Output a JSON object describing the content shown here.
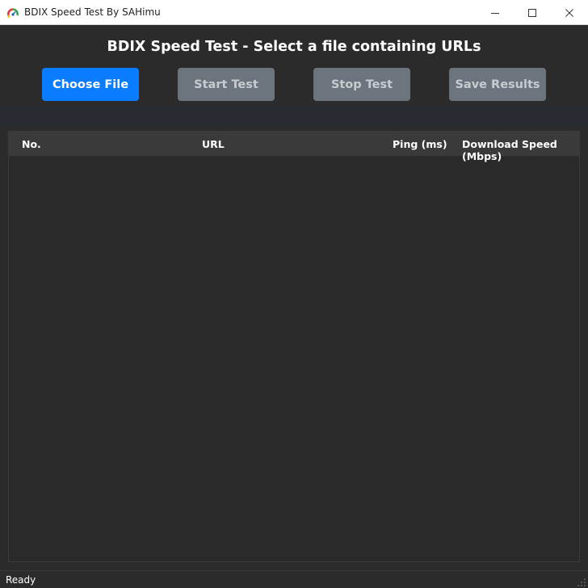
{
  "window": {
    "title": "BDIX Speed Test By SAHimu",
    "icon": "gauge-app-icon"
  },
  "header": {
    "title": "BDIX Speed Test - Select a file containing URLs"
  },
  "toolbar": {
    "choose_file_label": "Choose File",
    "start_test_label": "Start Test",
    "stop_test_label": "Stop Test",
    "save_results_label": "Save Results"
  },
  "results_table": {
    "columns": [
      "No.",
      "URL",
      "Ping (ms)",
      "Download Speed (Mbps)"
    ],
    "rows": []
  },
  "status": {
    "text": "Ready"
  },
  "colors": {
    "primary_button": "#0a7cff",
    "disabled_button": "#6c757d",
    "background": "#2b2b2b"
  }
}
